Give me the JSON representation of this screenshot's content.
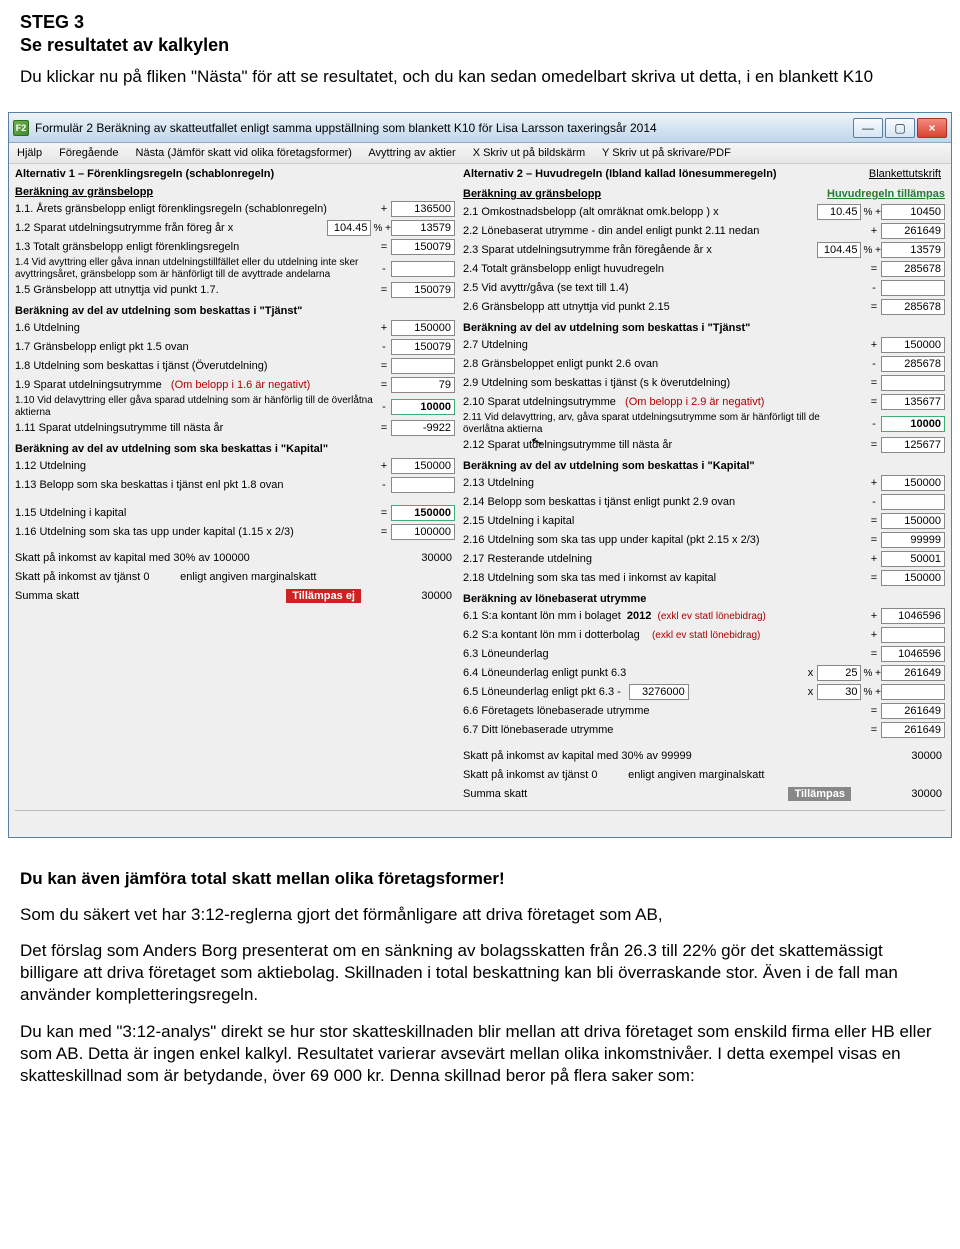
{
  "doc": {
    "step_title": "STEG 3",
    "step_subtitle": "Se resultatet av kalkylen",
    "intro": "Du klickar nu på fliken \"Nästa\" för att se resultatet, och du kan sedan omedelbart skriva ut detta,  i en blankett K10",
    "after_app_bold": "Du kan även jämföra total skatt mellan olika företagsformer!",
    "para1": "Som du säkert vet har 3:12-reglerna gjort det förmånligare att driva företaget som AB,",
    "para2": "Det förslag som Anders Borg presenterat om en sänkning av bolagsskatten från 26.3 till 22% gör det skattemässigt billigare att driva företaget som aktiebolag. Skillnaden i total beskattning kan bli överraskande stor. Även i de fall man använder kompletteringsregeln.",
    "para3": "Du kan med \"3:12-analys\" direkt se hur stor skatteskillnaden blir mellan att driva företaget som enskild firma eller HB  eller som  AB. Detta är ingen enkel kalkyl. Resultatet varierar avsevärt mellan olika inkomstnivåer. I detta exempel visas en skatteskillnad som är betydande, över 69 000 kr. Denna skillnad beror på flera saker som:"
  },
  "window": {
    "icon_label": "F2",
    "title": "Formulär 2    Beräkning av skatteutfallet enligt samma uppställning som blankett K10  för Lisa Larsson taxeringsår 2014",
    "menu": {
      "m1": "Hjälp",
      "m2": "Föregående",
      "m3": "Nästa (Jämför skatt vid olika företagsformer)",
      "m4": "Avyttring av aktier",
      "m5": "X Skriv ut på bildskärm",
      "m6": "Y Skriv ut på skrivare/PDF"
    },
    "win_btns": {
      "min": "—",
      "max": "▢",
      "close": "×"
    }
  },
  "form": {
    "topright": "Blankettutskrift",
    "left": {
      "alt_label": "Alternativ 1    – Förenklingsregeln (schablonregeln)",
      "sec1_h": "Beräkning av gränsbelopp",
      "r11": {
        "lbl": "1.1. Årets gränsbelopp enligt förenklingsregeln (schablonregeln)",
        "op": "+",
        "val": "136500"
      },
      "r12": {
        "lbl": "1.2  Sparat utdelningsutrymme från föreg år x",
        "pct": "104.45",
        "pct_sfx": "% +",
        "val": "13579"
      },
      "r13": {
        "lbl": "1.3  Totalt gränsbelopp enligt förenklingsregeln",
        "op": "=",
        "val": "150079"
      },
      "r14": {
        "lbl": "1.4  Vid avyttring eller gåva innan utdelningstillfället eller du utdelning inte sker avyttringsåret, gränsbelopp som är hänförligt till de avyttrade andelarna",
        "op": "-",
        "val": ""
      },
      "r15": {
        "lbl": "1.5  Gränsbelopp att utnyttja vid punkt 1.7.",
        "op": "=",
        "val": "150079"
      },
      "sec2_h": "Beräkning av del av utdelning som beskattas i \"Tjänst\"",
      "r16": {
        "lbl": "1.6 Utdelning",
        "op": "+",
        "val": "150000"
      },
      "r17": {
        "lbl": "1.7 Gränsbelopp enligt pkt 1.5 ovan",
        "op": "-",
        "val": "150079"
      },
      "r18": {
        "lbl": "1.8  Utdelning som beskattas i tjänst  (Överutdelning)",
        "op": "=",
        "val": ""
      },
      "r19": {
        "lbl": "1.9  Sparat utdelningsutrymme",
        "note": "(Om belopp i 1.6 är negativt)",
        "op": "=",
        "val": "79"
      },
      "r110": {
        "lbl": "1.10 Vid delavyttring eller gåva sparad utdelning som är hänförlig till de överlåtna aktierna",
        "op": "-",
        "val": "10000"
      },
      "r111": {
        "lbl": "1.11 Sparat utdelningsutrymme till nästa år",
        "op": "=",
        "val": "-9922"
      },
      "sec3_h": "Beräkning av del av utdelning som ska beskattas i \"Kapital\"",
      "r112": {
        "lbl": "1.12 Utdelning",
        "op": "+",
        "val": "150000"
      },
      "r113": {
        "lbl": "1.13 Belopp som ska beskattas i tjänst enl pkt 1.8 ovan",
        "op": "-",
        "val": ""
      },
      "r115": {
        "lbl": "1.15 Utdelning i kapital",
        "op": "=",
        "val": "150000"
      },
      "r116": {
        "lbl": "1.16 Utdelning  som ska tas upp under kapital (1.15 x 2/3)",
        "op": "=",
        "val": "100000"
      },
      "skatt_kap_lbl": "Skatt på inkomst av kapital med 30% av  100000",
      "skatt_kap_val": "30000",
      "skatt_tj_lbl": "Skatt på inkomst av tjänst 0",
      "skatt_tj_sfx": "enligt angiven marginalskatt",
      "summa_lbl": "Summa skatt",
      "summa_tag": "Tillämpas ej",
      "summa_val": "30000"
    },
    "right": {
      "alt_label": "Alternativ 2 – Huvudregeln   (Ibland kallad lönesummeregeln)",
      "alt_sub": "Huvudregeln tillämpas",
      "sec1_h": "Beräkning av gränsbelopp",
      "r21": {
        "lbl": "2.1  Omkostnadsbelopp (alt omräknat omk.belopp ) x",
        "pct": "10.45",
        "pct_sfx": "% +",
        "val": "10450"
      },
      "r22": {
        "lbl": "2.2  Lönebaserat utrymme - din andel enligt punkt 2.11 nedan",
        "op": "+",
        "val": "261649"
      },
      "r23": {
        "lbl": "2.3  Sparat utdelningsutrymme från föregående år   x",
        "pct": "104.45",
        "pct_sfx": "% +",
        "val": "13579"
      },
      "r24": {
        "lbl": "2.4  Totalt gränsbelopp enligt huvudregeln",
        "op": "=",
        "val": "285678"
      },
      "r25": {
        "lbl": "2.5  Vid avyttr/gåva (se text till 1.4)",
        "op": "-",
        "val": ""
      },
      "r26": {
        "lbl": "2.6  Gränsbelopp att utnyttja vid punkt 2.15",
        "op": "=",
        "val": "285678"
      },
      "sec2_h": "Beräkning av del av utdelning som beskattas i \"Tjänst\"",
      "r27": {
        "lbl": "2.7  Utdelning",
        "op": "+",
        "val": "150000"
      },
      "r28": {
        "lbl": "2.8  Gränsbeloppet enligt punkt 2.6 ovan",
        "op": "-",
        "val": "285678"
      },
      "r29": {
        "lbl": "2.9  Utdelning som beskattas i tjänst  (s k överutdelning)",
        "op": "=",
        "val": ""
      },
      "r210": {
        "lbl": "2.10 Sparat utdelningsutrymme",
        "note": "(Om belopp i 2.9 är negativt)",
        "op": "=",
        "val": "135677"
      },
      "r211": {
        "lbl": "2.11 Vid delavyttring, arv, gåva sparat utdelningsutrymme som är hänförligt till de överlåtna aktierna",
        "op": "-",
        "val": "10000"
      },
      "r212": {
        "lbl": "2.12 Sparat utdelningsutrymme till nästa år",
        "op": "=",
        "val": "125677"
      },
      "sec3_h": "Beräkning av del av utdelning som beskattas i \"Kapital\"",
      "r213": {
        "lbl": "2.13 Utdelning",
        "op": "+",
        "val": "150000"
      },
      "r214": {
        "lbl": "2.14 Belopp som beskattas i tjänst enligt punkt 2.9 ovan",
        "op": "-",
        "val": ""
      },
      "r215": {
        "lbl": "2.15 Utdelning i kapital",
        "op": "=",
        "val": "150000"
      },
      "r216": {
        "lbl": "2.16 Utdelning  som ska tas upp under kapital (pkt 2.15 x 2/3)",
        "op": "=",
        "val": "99999"
      },
      "r217": {
        "lbl": "2.17 Resterande utdelning",
        "op": "+",
        "val": "50001"
      },
      "r218": {
        "lbl": "2.18 Utdelning som ska tas med i inkomst av kapital",
        "op": "=",
        "val": "150000"
      },
      "sec4_h": "Beräkning av lönebaserat utrymme",
      "r61_year": "2012",
      "r61": {
        "lbl": "6.1  S:a kontant lön mm i bolaget",
        "note": "(exkl ev statl lönebidrag)",
        "op": "+",
        "val": "1046596"
      },
      "r62": {
        "lbl": "6.2  S:a kontant lön mm i dotterbolag",
        "note": "(exkl ev statl lönebidrag)",
        "op": "+",
        "val": ""
      },
      "r63": {
        "lbl": "6.3  Löneunderlag",
        "op": "=",
        "val": "1046596"
      },
      "r64": {
        "lbl": "6.4  Löneunderlag enligt punkt 6.3",
        "op": "x",
        "pct": "25",
        "pct_sfx": "% +",
        "val": "261649"
      },
      "r65": {
        "lbl": "6.5  Löneunderlag enligt pkt 6.3 -",
        "base": "3276000",
        "op": "x",
        "pct": "30",
        "pct_sfx": "% +",
        "val": ""
      },
      "r66": {
        "lbl": "6.6  Företagets lönebaserade utrymme",
        "op": "=",
        "val": "261649"
      },
      "r67": {
        "lbl": "6.7  Ditt lönebaserade utrymme",
        "op": "=",
        "val": "261649"
      },
      "skatt_kap_lbl": "Skatt på inkomst av kapital med 30% av 99999",
      "skatt_kap_val": "30000",
      "skatt_tj_lbl": "Skatt på inkomst av tjänst 0",
      "skatt_tj_sfx": "enligt angiven marginalskatt",
      "summa_lbl": "Summa skatt",
      "summa_tag": "Tillämpas",
      "summa_val": "30000"
    }
  }
}
